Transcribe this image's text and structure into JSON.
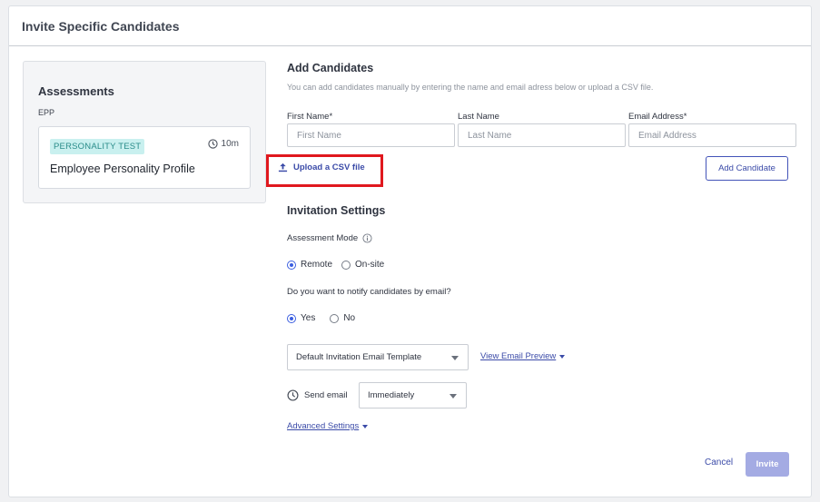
{
  "modal": {
    "title": "Invite Specific Candidates"
  },
  "assessments": {
    "heading": "Assessments",
    "code": "EPP",
    "card": {
      "badge": "PERSONALITY TEST",
      "duration": "10m",
      "name": "Employee Personality Profile"
    }
  },
  "add_candidates": {
    "title": "Add Candidates",
    "helper": "You can add candidates manually by entering the name and email adress below or upload a CSV file.",
    "first_name": {
      "label": "First Name*",
      "placeholder": "First Name"
    },
    "last_name": {
      "label": "Last Name",
      "placeholder": "Last Name"
    },
    "email": {
      "label": "Email Address*",
      "placeholder": "Email Address"
    },
    "upload_label": "Upload a CSV file",
    "add_button": "Add Candidate"
  },
  "invitation": {
    "title": "Invitation Settings",
    "mode_label": "Assessment Mode",
    "mode_options": [
      "Remote",
      "On-site"
    ],
    "mode_selected": "Remote",
    "notify_label": "Do you want to notify candidates by email?",
    "notify_options": [
      "Yes",
      "No"
    ],
    "notify_selected": "Yes",
    "template_value": "Default Invitation Email Template",
    "preview_link": "View Email Preview",
    "send_email_label": "Send email",
    "send_value": "Immediately",
    "advanced_link": "Advanced Settings"
  },
  "footer": {
    "cancel": "Cancel",
    "invite": "Invite"
  },
  "colors": {
    "accent": "#3b4ba8",
    "highlight": "#e0181e",
    "badge_bg": "#c9f0ef",
    "invite_disabled": "#a4abe3"
  }
}
